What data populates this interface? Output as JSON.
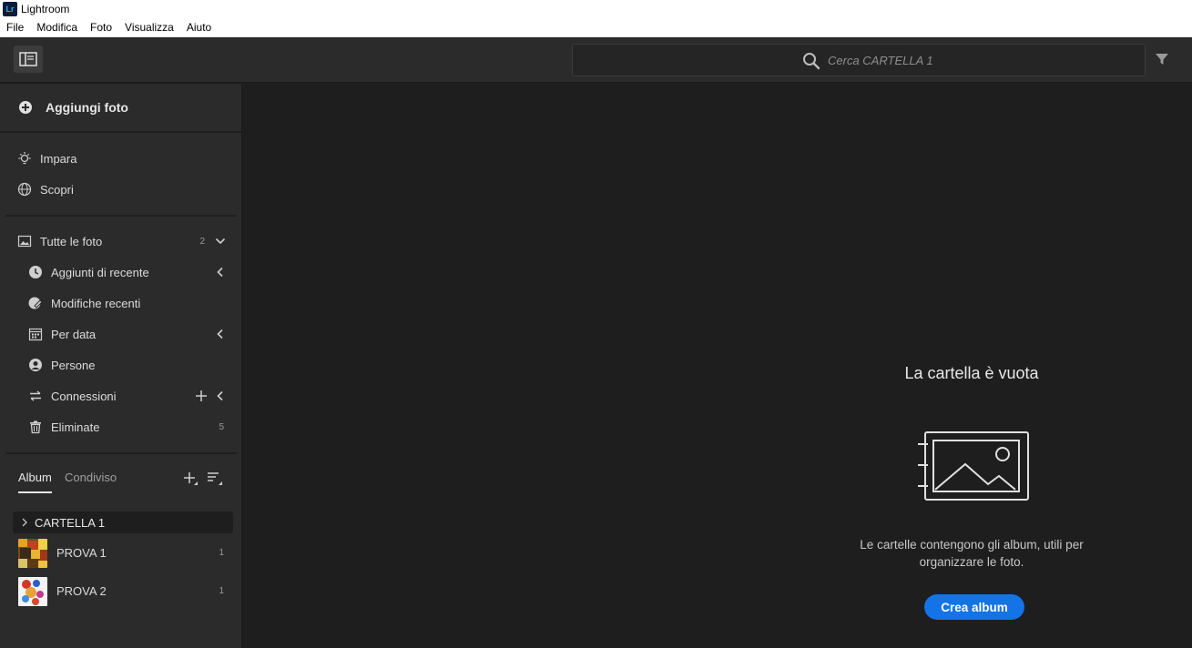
{
  "window": {
    "logo_text": "Lr",
    "title": "Lightroom"
  },
  "menu": [
    "File",
    "Modifica",
    "Foto",
    "Visualizza",
    "Aiuto"
  ],
  "search": {
    "placeholder": "Cerca CARTELLA 1"
  },
  "sidebar": {
    "add_photos": "Aggiungi foto",
    "primary": [
      {
        "label": "Impara",
        "icon": "lightbulb-icon"
      },
      {
        "label": "Scopri",
        "icon": "globe-icon"
      }
    ],
    "library": {
      "all_photos": {
        "label": "Tutte le foto",
        "count": "2"
      },
      "items": [
        {
          "label": "Aggiunti di recente",
          "icon": "clock-icon"
        },
        {
          "label": "Modifiche recenti",
          "icon": "edit-history-icon"
        },
        {
          "label": "Per data",
          "icon": "calendar-icon"
        },
        {
          "label": "Persone",
          "icon": "person-icon"
        },
        {
          "label": "Connessioni",
          "icon": "connections-icon"
        },
        {
          "label": "Eliminate",
          "icon": "trash-icon",
          "count": "5"
        }
      ]
    },
    "tabs": [
      {
        "label": "Album",
        "active": true
      },
      {
        "label": "Condiviso",
        "active": false
      }
    ],
    "folder": {
      "label": "CARTELLA 1"
    },
    "albums": [
      {
        "label": "PROVA 1",
        "count": "1"
      },
      {
        "label": "PROVA 2",
        "count": "1"
      }
    ]
  },
  "empty_state": {
    "title": "La cartella è vuota",
    "description_line1": "Le cartelle contengono gli album, utili per",
    "description_line2": "organizzare le foto.",
    "button": "Crea album"
  },
  "colors": {
    "accent": "#1473e6",
    "panel": "#2b2b2b",
    "background": "#1e1e1e",
    "logo_bg": "#0b1d3a",
    "logo_fg": "#31a8ff"
  }
}
